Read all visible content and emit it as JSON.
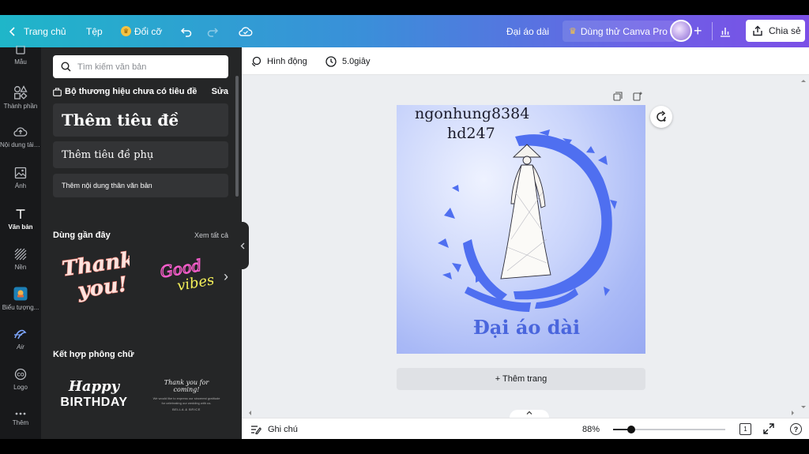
{
  "topbar": {
    "home": "Trang chủ",
    "file": "Tệp",
    "resize": "Đổi cỡ",
    "doc_title": "Đại áo dài",
    "pro_trial": "Dùng thử Canva Pro",
    "share": "Chia sẻ"
  },
  "rail": [
    {
      "label": "Mẫu",
      "icon": "template-icon"
    },
    {
      "label": "Thành phần",
      "icon": "elements-icon"
    },
    {
      "label": "Nội dung tải lên",
      "icon": "upload-icon"
    },
    {
      "label": "Ảnh",
      "icon": "photo-icon"
    },
    {
      "label": "Văn bản",
      "icon": "text-icon"
    },
    {
      "label": "Nền",
      "icon": "background-icon"
    },
    {
      "label": "Biểu tượng...",
      "icon": "logo-app-icon"
    },
    {
      "label": "Air",
      "icon": "air-icon"
    },
    {
      "label": "Logo",
      "icon": "logo-icon"
    },
    {
      "label": "Thêm",
      "icon": "more-icon"
    }
  ],
  "panel": {
    "search_placeholder": "Tìm kiếm văn bản",
    "brand_kit": "Bộ thương hiệu chưa có tiêu đề",
    "brand_edit": "Sửa",
    "add_heading": "Thêm tiêu đề",
    "add_subheading": "Thêm tiêu đề phụ",
    "add_body": "Thêm nội dung thân văn bản",
    "recent": "Dùng gần đây",
    "see_all": "Xem tất cả",
    "sticker1_line1": "Thank",
    "sticker1_line2": "you!",
    "sticker2_line1": "Good",
    "sticker2_line2": "vibes",
    "font_combos": "Kết hợp phông chữ",
    "combo1_line1": "Happy",
    "combo1_line2": "BIRTHDAY",
    "combo2_line1": "Thank you for coming!",
    "combo2_line2": "We would like to express our sincerest gratitude for celebrating our wedding with us.",
    "combo2_line3": "BELLA & BRICE"
  },
  "editor": {
    "animate": "Hình động",
    "duration": "5.0giây"
  },
  "design": {
    "username_line1": "ngonhung8384",
    "username_line2": "hd247",
    "title": "Đại áo dài"
  },
  "canvas": {
    "add_page": "+ Thêm trang"
  },
  "footer": {
    "notes": "Ghi chú",
    "zoom": "88%",
    "zoom_level": 0.164,
    "page_count": "1",
    "help": "?"
  },
  "colors": {
    "accent_gradient_start": "#1fb6c9",
    "accent_gradient_end": "#7b4fe6",
    "panel_bg": "#252627",
    "rail_bg": "#18191b",
    "design_text_blue": "#4a66dd"
  }
}
